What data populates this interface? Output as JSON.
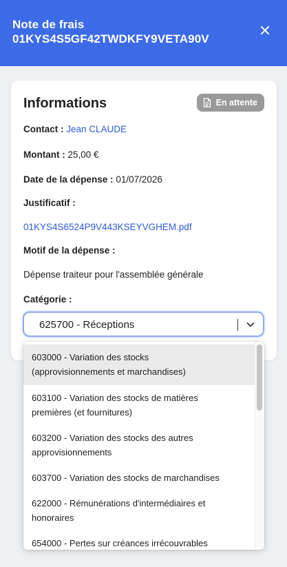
{
  "header": {
    "title_line1": "Note de frais",
    "title_line2": "01KYS4S5GF42TWDKFY9VETA90V",
    "close_icon": "close-icon"
  },
  "card": {
    "title": "Informations",
    "status_badge": "En attente",
    "status_icon": "document-icon",
    "contact_label": "Contact :",
    "contact_value": "Jean CLAUDE",
    "amount_label": "Montant :",
    "amount_value": "25,00 €",
    "date_label": "Date de la dépense :",
    "date_value": "01/07/2026",
    "receipt_label": "Justificatif :",
    "receipt_file": "01KYS4S6524P9V443KSEYVGHEM.pdf",
    "reason_label": "Motif de la dépense :",
    "reason_value": "Dépense traiteur pour l'assemblée générale",
    "category_label": "Catégorie :",
    "category_selected": "625700 - Réceptions"
  },
  "dropdown": {
    "options": [
      {
        "line1": "603000 - Variation des stocks",
        "line2": "(approvisionnements et marchandises)"
      },
      {
        "line1": "603100 - Variation des stocks de matières",
        "line2": "premières (et fournitures)"
      },
      {
        "line1": "603200 - Variation des stocks des autres",
        "line2": "approvisionnements"
      },
      {
        "line1": "603700 - Variation des stocks de marchandises",
        "line2": ""
      },
      {
        "line1": "622000 - Rémunérations d'intermédiaires et",
        "line2": "honoraires"
      },
      {
        "line1": "654000 - Pertes sur créances irrécouvrables",
        "line2": ""
      }
    ]
  },
  "colors": {
    "header_bg": "#3d6be8",
    "link": "#2f5bd6",
    "badge_bg": "#9a9a9a",
    "select_border": "#8fa9ee"
  }
}
